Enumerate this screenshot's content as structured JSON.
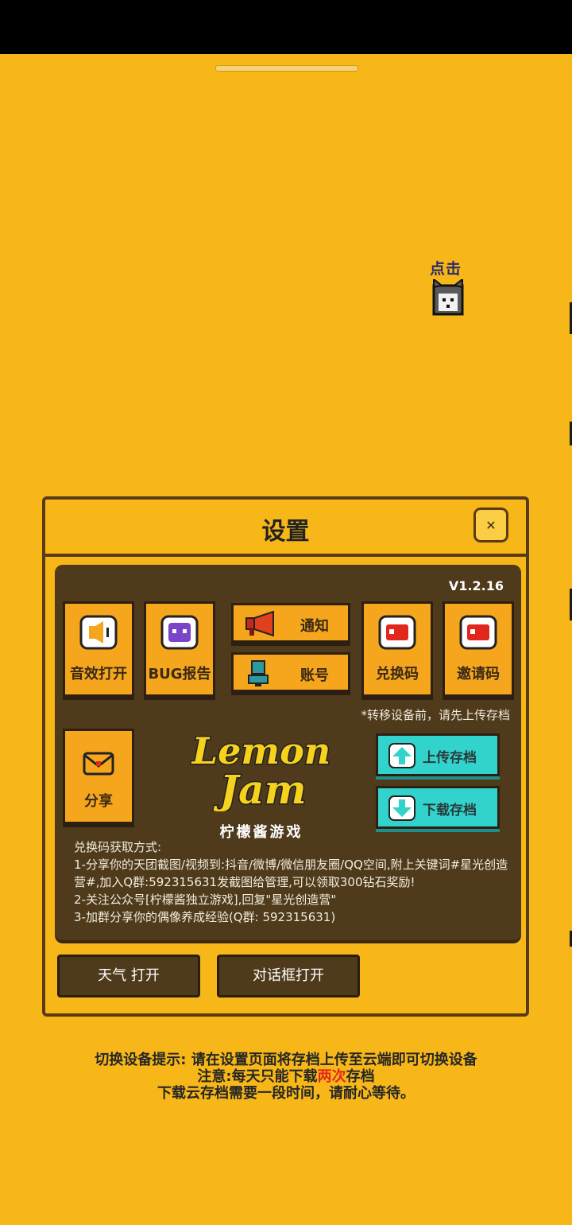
{
  "hint": {
    "label": "点击"
  },
  "settings": {
    "title": "设置",
    "close_icon": "close-icon",
    "version": "V1.2.16",
    "buttons": {
      "sound": "音效打开",
      "bug": "BUG报告",
      "notice": "通知",
      "account": "账号",
      "redeem": "兑换码",
      "invite": "邀请码",
      "share": "分享"
    },
    "transfer_note": "*转移设备前，请先上传存档",
    "upload": "上传存档",
    "download": "下载存档",
    "logo_text": "Lemon Jam",
    "logo_sub": "柠檬酱游戏",
    "info": [
      "兑换码获取方式:",
      "1-分享你的天团截图/视频到:抖音/微博/微信朋友圈/QQ空间,附上关键词#星光创造营#,加入Q群:592315631发截图给管理,可以领取300钻石奖励!",
      "2-关注公众号[柠檬酱独立游戏],回复\"星光创造营\"",
      "3-加群分享你的偶像养成经验(Q群: 592315631)"
    ],
    "weather_toggle": "天气 打开",
    "dialog_toggle": "对话框打开"
  },
  "footer": {
    "line1": "切换设备提示: 请在设置页面将存档上传至云端即可切换设备",
    "line2_a": "注意:每天只能下载",
    "line2_b": "两次",
    "line2_c": "存档",
    "line3": "下载云存档需要一段时间，请耐心等待。"
  },
  "colors": {
    "background": "#f7b718",
    "panel_inner": "#4f3a1c",
    "tile": "#f6a61c",
    "cloud": "#33d3cd",
    "highlight": "#e0281c"
  }
}
